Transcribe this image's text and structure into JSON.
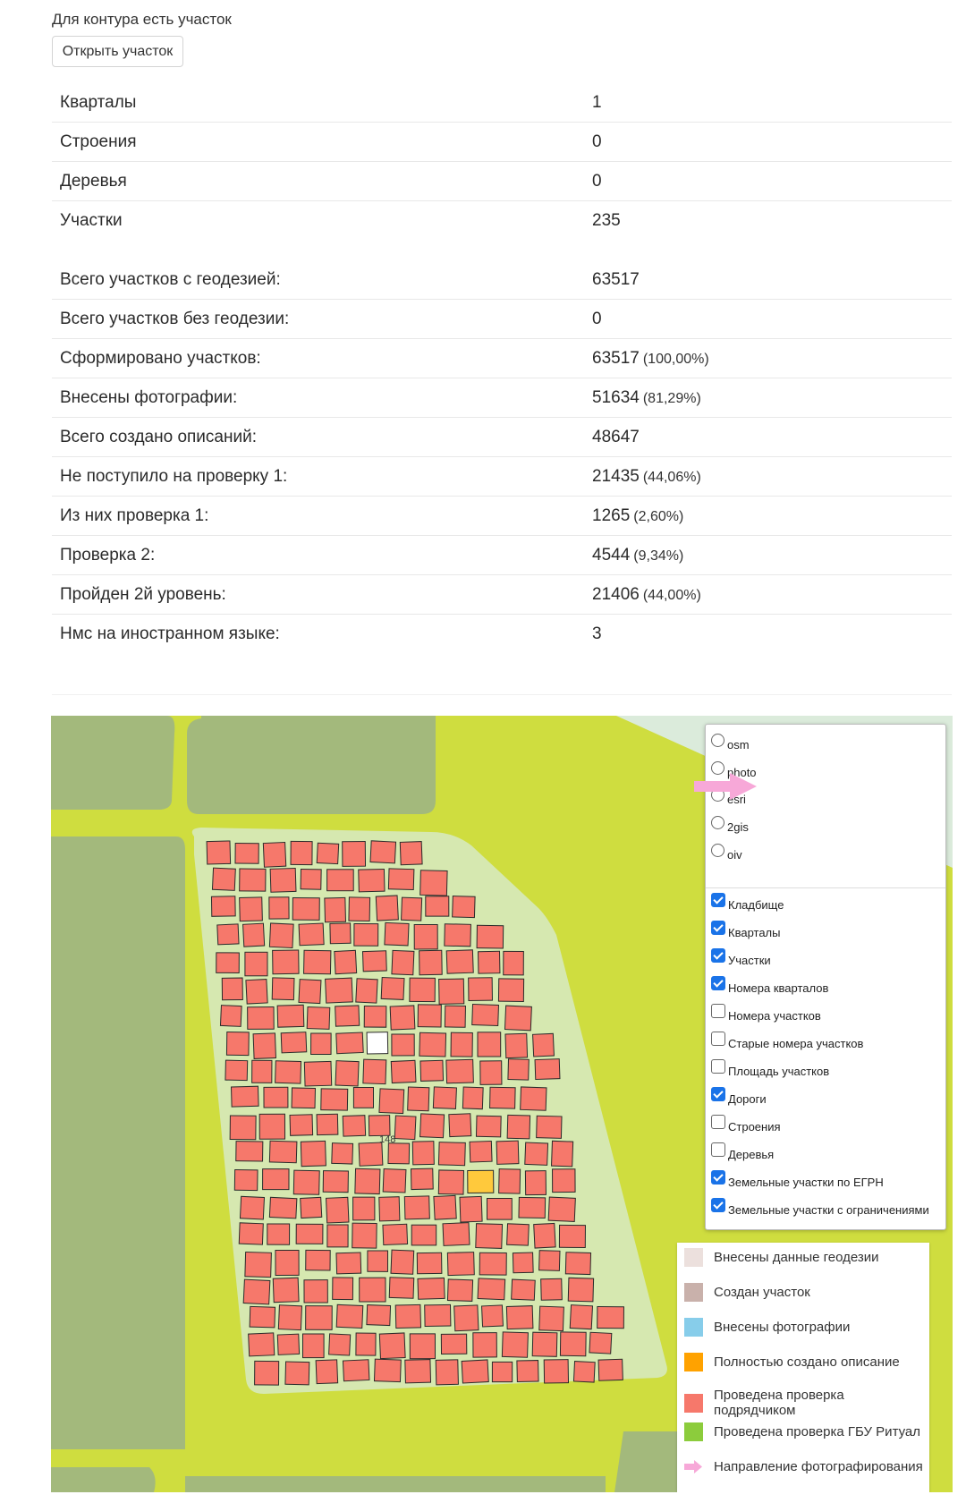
{
  "header": {
    "note": "Для контура есть участок",
    "open_button": "Открыть участок"
  },
  "summary": [
    {
      "label": "Кварталы",
      "value": "1"
    },
    {
      "label": "Строения",
      "value": "0"
    },
    {
      "label": "Деревья",
      "value": "0"
    },
    {
      "label": "Участки",
      "value": "235"
    }
  ],
  "stats": [
    {
      "label": "Всего участков с геодезией:",
      "value": "63517",
      "pct": ""
    },
    {
      "label": "Всего участков без геодезии:",
      "value": "0",
      "pct": ""
    },
    {
      "label": "Сформировано участков:",
      "value": "63517",
      "pct": "(100,00%)"
    },
    {
      "label": "Внесены фотографии:",
      "value": "51634",
      "pct": "(81,29%)"
    },
    {
      "label": "Всего создано описаний:",
      "value": "48647",
      "pct": ""
    },
    {
      "label": "Не поступило на проверку 1:",
      "value": "21435",
      "pct": "(44,06%)"
    },
    {
      "label": "Из них проверка 1:",
      "value": "1265",
      "pct": "(2,60%)"
    },
    {
      "label": "Проверка 2:",
      "value": "4544",
      "pct": "(9,34%)"
    },
    {
      "label": "Пройден 2й уровень:",
      "value": "21406",
      "pct": "(44,00%)"
    },
    {
      "label": "Нмс на иностранном языке:",
      "value": "3",
      "pct": ""
    }
  ],
  "map": {
    "plot_label": "148",
    "basemaps": [
      "osm",
      "photo",
      "esri",
      "2gis",
      "oiv"
    ],
    "layers": [
      {
        "label": "Кладбище",
        "checked": true
      },
      {
        "label": "Кварталы",
        "checked": true
      },
      {
        "label": "Участки",
        "checked": true
      },
      {
        "label": "Номера кварталов",
        "checked": true
      },
      {
        "label": "Номера участков",
        "checked": false
      },
      {
        "label": "Старые номера участков",
        "checked": false
      },
      {
        "label": "Площадь участков",
        "checked": false
      },
      {
        "label": "Дороги",
        "checked": true
      },
      {
        "label": "Строения",
        "checked": false
      },
      {
        "label": "Деревья",
        "checked": false
      },
      {
        "label": "Земельные участки по ЕГРН",
        "checked": true
      },
      {
        "label": "Земельные участки с ограничениями",
        "checked": true
      }
    ],
    "legend": [
      {
        "label": "Внесены данные геодезии",
        "color": "#ece0dd"
      },
      {
        "label": "Создан участок",
        "color": "#c9b1ab"
      },
      {
        "label": "Внесены фотографии",
        "color": "#87cdea"
      },
      {
        "label": "Полностью создано описание",
        "color": "#ffa200"
      },
      {
        "label": "Проведена проверка подрядчиком",
        "color": "#f6786b"
      },
      {
        "label": "Проведена проверка ГБУ Ритуал",
        "color": "#8ccc3c"
      },
      {
        "label": "Направление фотографирования",
        "color": "#f7a8d8"
      }
    ],
    "colors": {
      "plot": "#f6786b",
      "plot_outline": "#2a2a2a",
      "plot_empty": "#ffffff",
      "plot_selected": "#ffc93c",
      "field": "#a3b97c",
      "road": "#cfdd3f",
      "quarter": "#d6e8b0",
      "corner": "#dbebdb"
    }
  }
}
